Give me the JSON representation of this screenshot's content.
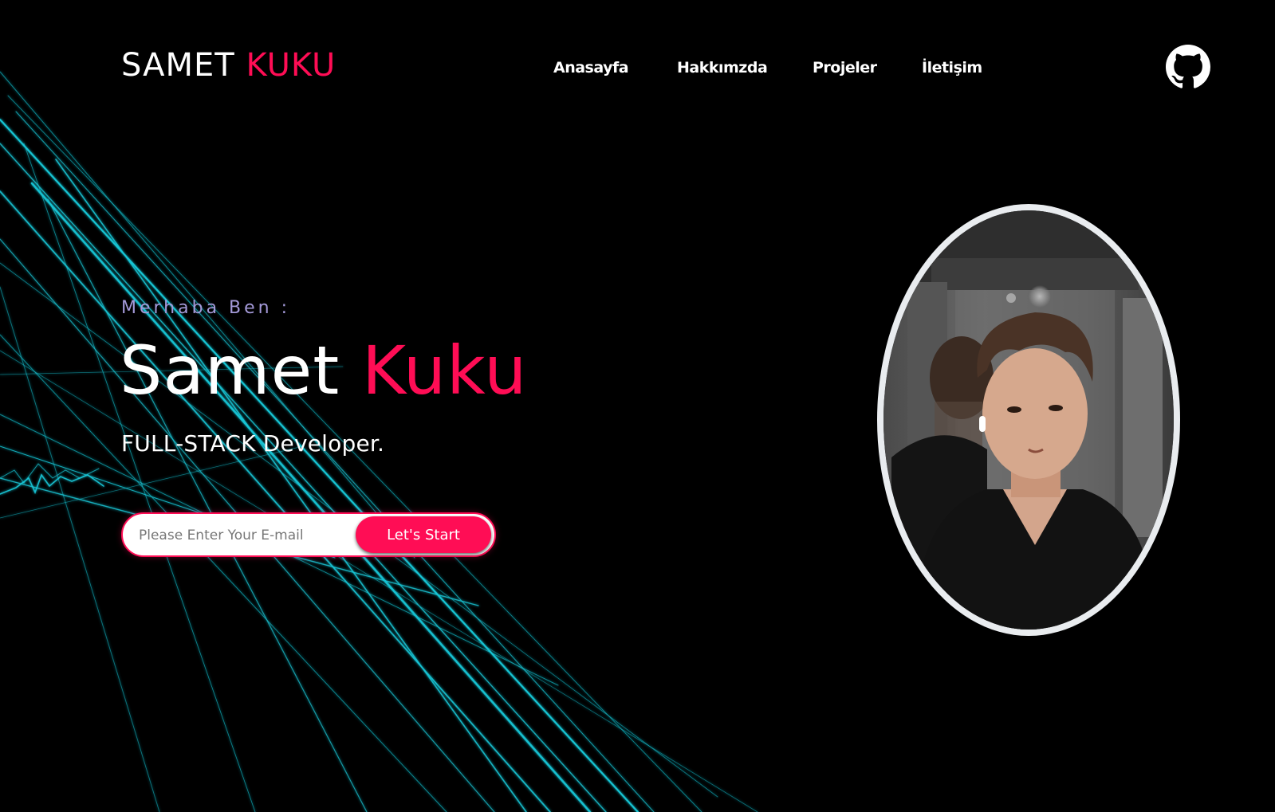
{
  "header": {
    "logo_first": "SAMET",
    "logo_last": "KUKU",
    "nav": [
      "Anasayfa",
      "Hakkımzda",
      "Projeler",
      "İletişim"
    ],
    "github_icon": "github-icon"
  },
  "hero": {
    "greeting": "Merhaba Ben :",
    "name_first": "Samet",
    "name_last": "Kuku",
    "role": "FULL-STACK Developer.",
    "email_placeholder": "Please Enter Your E-mail",
    "cta_label": "Let's Start"
  },
  "portrait": {
    "image": "profile-photo"
  },
  "colors": {
    "background": "#000000",
    "accent": "#ff0d55",
    "greeting": "#a49ad9",
    "streaks": "#19c9d9",
    "portrait_border": "#e9ecef"
  }
}
